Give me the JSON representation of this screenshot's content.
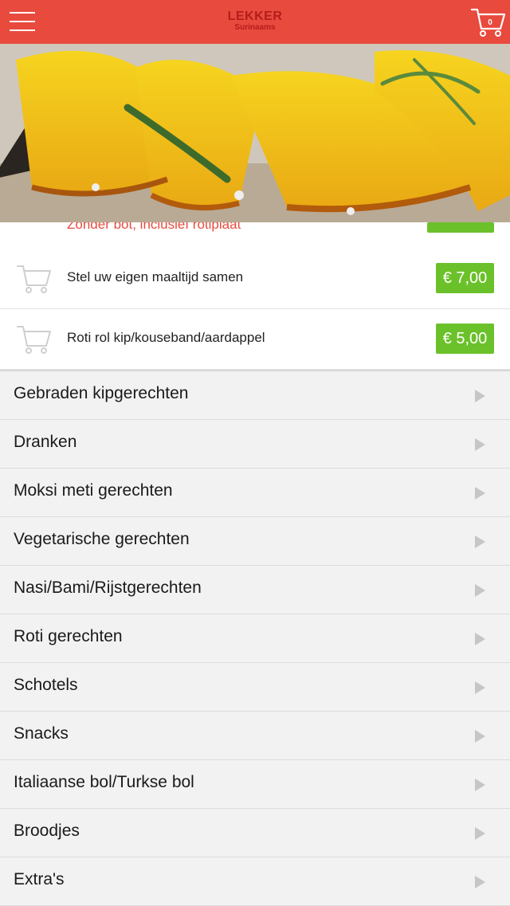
{
  "header": {
    "logo_main": "LEKKER",
    "logo_sub": "Surinaams",
    "cart_count": "0"
  },
  "scrolled_item": {
    "name": "Zonder bot, inclusief rotiplaat"
  },
  "items": [
    {
      "name": "Stel uw eigen maaltijd samen",
      "price": "€ 7,00"
    },
    {
      "name": "Roti rol kip/kouseband/aardappel",
      "price": "€ 5,00"
    }
  ],
  "categories": [
    {
      "label": "Gebraden kipgerechten"
    },
    {
      "label": "Dranken"
    },
    {
      "label": "Moksi meti gerechten"
    },
    {
      "label": "Vegetarische gerechten"
    },
    {
      "label": "Nasi/Bami/Rijstgerechten"
    },
    {
      "label": "Roti gerechten"
    },
    {
      "label": "Schotels"
    },
    {
      "label": "Snacks"
    },
    {
      "label": "Italiaanse bol/Turkse bol"
    },
    {
      "label": "Broodjes"
    },
    {
      "label": "Extra's"
    }
  ],
  "colors": {
    "header": "#e84a3d",
    "price_badge": "#6bc12a",
    "logo": "#b51c1c"
  }
}
